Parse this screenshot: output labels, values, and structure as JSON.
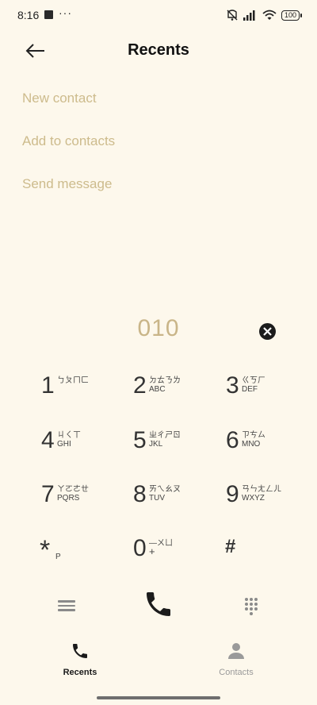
{
  "status_bar": {
    "time": "8:16",
    "dots": "···",
    "battery": "100"
  },
  "header": {
    "title": "Recents"
  },
  "actions": [
    {
      "label": "New contact"
    },
    {
      "label": "Add to contacts"
    },
    {
      "label": "Send message"
    }
  ],
  "dial": {
    "number": "010"
  },
  "keys": [
    {
      "digit": "1",
      "zhuyin": "ㄅㄆㄇㄈ",
      "letters": ""
    },
    {
      "digit": "2",
      "zhuyin": "ㄉㄊㄋㄌ",
      "letters": "ABC"
    },
    {
      "digit": "3",
      "zhuyin": "ㄍㄎㄏ",
      "letters": "DEF"
    },
    {
      "digit": "4",
      "zhuyin": "ㄐㄑㄒ",
      "letters": "GHI"
    },
    {
      "digit": "5",
      "zhuyin": "ㄓㄔㄕㄖ",
      "letters": "JKL"
    },
    {
      "digit": "6",
      "zhuyin": "ㄗㄘㄙ",
      "letters": "MNO"
    },
    {
      "digit": "7",
      "zhuyin": "ㄚㄛㄜㄝ",
      "letters": "PQRS"
    },
    {
      "digit": "8",
      "zhuyin": "ㄞㄟㄠㄡ",
      "letters": "TUV"
    },
    {
      "digit": "9",
      "zhuyin": "ㄢㄣㄤㄥㄦ",
      "letters": "WXYZ"
    },
    {
      "digit": "*",
      "zhuyin": "",
      "letters": "P"
    },
    {
      "digit": "0",
      "zhuyin": "—ㄨㄩ",
      "letters": "+"
    },
    {
      "digit": "#",
      "zhuyin": "",
      "letters": ""
    }
  ],
  "nav": {
    "recents_label": "Recents",
    "contacts_label": "Contacts"
  },
  "colors": {
    "background": "#fdf8ec",
    "accent_text": "#cdbb8c",
    "active": "#1a1a1a",
    "inactive": "#9a9a9a"
  },
  "icons": [
    "back-arrow-icon",
    "mute-icon",
    "signal-icon",
    "wifi-icon",
    "battery-icon",
    "clear-icon",
    "menu-icon",
    "phone-icon",
    "dialpad-icon",
    "contact-person-icon"
  ]
}
